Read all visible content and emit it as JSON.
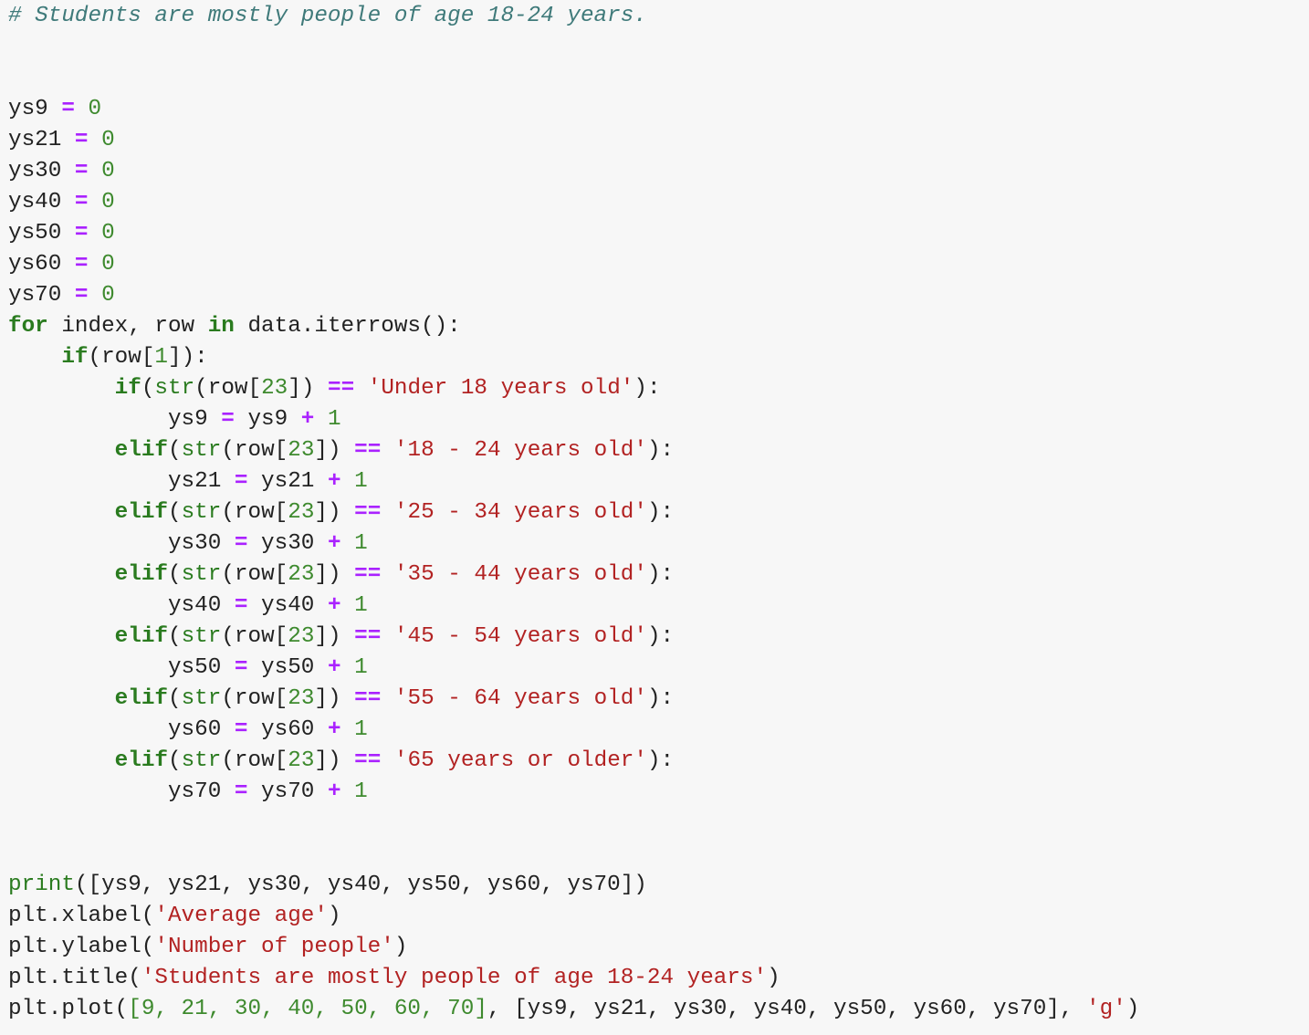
{
  "colors": {
    "background": "#f7f7f7",
    "plain": "#222222",
    "keyword": "#2a7b1f",
    "operator": "#aa22ff",
    "number": "#3e8a2e",
    "string": "#b22222",
    "builtin": "#2a7b1f",
    "comment": "#3f7a7a"
  },
  "code_lines": [
    [
      [
        "comment",
        "# Students are mostly people of age 18-24 years."
      ]
    ],
    [],
    [],
    [
      [
        "plain",
        "ys9 "
      ],
      [
        "op",
        "="
      ],
      [
        "plain",
        " "
      ],
      [
        "num",
        "0"
      ]
    ],
    [
      [
        "plain",
        "ys21 "
      ],
      [
        "op",
        "="
      ],
      [
        "plain",
        " "
      ],
      [
        "num",
        "0"
      ]
    ],
    [
      [
        "plain",
        "ys30 "
      ],
      [
        "op",
        "="
      ],
      [
        "plain",
        " "
      ],
      [
        "num",
        "0"
      ]
    ],
    [
      [
        "plain",
        "ys40 "
      ],
      [
        "op",
        "="
      ],
      [
        "plain",
        " "
      ],
      [
        "num",
        "0"
      ]
    ],
    [
      [
        "plain",
        "ys50 "
      ],
      [
        "op",
        "="
      ],
      [
        "plain",
        " "
      ],
      [
        "num",
        "0"
      ]
    ],
    [
      [
        "plain",
        "ys60 "
      ],
      [
        "op",
        "="
      ],
      [
        "plain",
        " "
      ],
      [
        "num",
        "0"
      ]
    ],
    [
      [
        "plain",
        "ys70 "
      ],
      [
        "op",
        "="
      ],
      [
        "plain",
        " "
      ],
      [
        "num",
        "0"
      ]
    ],
    [
      [
        "kw",
        "for"
      ],
      [
        "plain",
        " index, row "
      ],
      [
        "kw",
        "in"
      ],
      [
        "plain",
        " data.iterrows():"
      ]
    ],
    [
      [
        "plain",
        "    "
      ],
      [
        "kw",
        "if"
      ],
      [
        "plain",
        "(row["
      ],
      [
        "num",
        "1"
      ],
      [
        "plain",
        "]):"
      ]
    ],
    [
      [
        "plain",
        "        "
      ],
      [
        "kw",
        "if"
      ],
      [
        "plain",
        "("
      ],
      [
        "builtin",
        "str"
      ],
      [
        "plain",
        "(row["
      ],
      [
        "num",
        "23"
      ],
      [
        "plain",
        "]) "
      ],
      [
        "op",
        "=="
      ],
      [
        "plain",
        " "
      ],
      [
        "str",
        "'Under 18 years old'"
      ],
      [
        "plain",
        "):"
      ]
    ],
    [
      [
        "plain",
        "            ys9 "
      ],
      [
        "op",
        "="
      ],
      [
        "plain",
        " ys9 "
      ],
      [
        "op",
        "+"
      ],
      [
        "plain",
        " "
      ],
      [
        "num",
        "1"
      ]
    ],
    [
      [
        "plain",
        "        "
      ],
      [
        "kw",
        "elif"
      ],
      [
        "plain",
        "("
      ],
      [
        "builtin",
        "str"
      ],
      [
        "plain",
        "(row["
      ],
      [
        "num",
        "23"
      ],
      [
        "plain",
        "]) "
      ],
      [
        "op",
        "=="
      ],
      [
        "plain",
        " "
      ],
      [
        "str",
        "'18 - 24 years old'"
      ],
      [
        "plain",
        "):"
      ]
    ],
    [
      [
        "plain",
        "            ys21 "
      ],
      [
        "op",
        "="
      ],
      [
        "plain",
        " ys21 "
      ],
      [
        "op",
        "+"
      ],
      [
        "plain",
        " "
      ],
      [
        "num",
        "1"
      ]
    ],
    [
      [
        "plain",
        "        "
      ],
      [
        "kw",
        "elif"
      ],
      [
        "plain",
        "("
      ],
      [
        "builtin",
        "str"
      ],
      [
        "plain",
        "(row["
      ],
      [
        "num",
        "23"
      ],
      [
        "plain",
        "]) "
      ],
      [
        "op",
        "=="
      ],
      [
        "plain",
        " "
      ],
      [
        "str",
        "'25 - 34 years old'"
      ],
      [
        "plain",
        "):"
      ]
    ],
    [
      [
        "plain",
        "            ys30 "
      ],
      [
        "op",
        "="
      ],
      [
        "plain",
        " ys30 "
      ],
      [
        "op",
        "+"
      ],
      [
        "plain",
        " "
      ],
      [
        "num",
        "1"
      ]
    ],
    [
      [
        "plain",
        "        "
      ],
      [
        "kw",
        "elif"
      ],
      [
        "plain",
        "("
      ],
      [
        "builtin",
        "str"
      ],
      [
        "plain",
        "(row["
      ],
      [
        "num",
        "23"
      ],
      [
        "plain",
        "]) "
      ],
      [
        "op",
        "=="
      ],
      [
        "plain",
        " "
      ],
      [
        "str",
        "'35 - 44 years old'"
      ],
      [
        "plain",
        "):"
      ]
    ],
    [
      [
        "plain",
        "            ys40 "
      ],
      [
        "op",
        "="
      ],
      [
        "plain",
        " ys40 "
      ],
      [
        "op",
        "+"
      ],
      [
        "plain",
        " "
      ],
      [
        "num",
        "1"
      ]
    ],
    [
      [
        "plain",
        "        "
      ],
      [
        "kw",
        "elif"
      ],
      [
        "plain",
        "("
      ],
      [
        "builtin",
        "str"
      ],
      [
        "plain",
        "(row["
      ],
      [
        "num",
        "23"
      ],
      [
        "plain",
        "]) "
      ],
      [
        "op",
        "=="
      ],
      [
        "plain",
        " "
      ],
      [
        "str",
        "'45 - 54 years old'"
      ],
      [
        "plain",
        "):"
      ]
    ],
    [
      [
        "plain",
        "            ys50 "
      ],
      [
        "op",
        "="
      ],
      [
        "plain",
        " ys50 "
      ],
      [
        "op",
        "+"
      ],
      [
        "plain",
        " "
      ],
      [
        "num",
        "1"
      ]
    ],
    [
      [
        "plain",
        "        "
      ],
      [
        "kw",
        "elif"
      ],
      [
        "plain",
        "("
      ],
      [
        "builtin",
        "str"
      ],
      [
        "plain",
        "(row["
      ],
      [
        "num",
        "23"
      ],
      [
        "plain",
        "]) "
      ],
      [
        "op",
        "=="
      ],
      [
        "plain",
        " "
      ],
      [
        "str",
        "'55 - 64 years old'"
      ],
      [
        "plain",
        "):"
      ]
    ],
    [
      [
        "plain",
        "            ys60 "
      ],
      [
        "op",
        "="
      ],
      [
        "plain",
        " ys60 "
      ],
      [
        "op",
        "+"
      ],
      [
        "plain",
        " "
      ],
      [
        "num",
        "1"
      ]
    ],
    [
      [
        "plain",
        "        "
      ],
      [
        "kw",
        "elif"
      ],
      [
        "plain",
        "("
      ],
      [
        "builtin",
        "str"
      ],
      [
        "plain",
        "(row["
      ],
      [
        "num",
        "23"
      ],
      [
        "plain",
        "]) "
      ],
      [
        "op",
        "=="
      ],
      [
        "plain",
        " "
      ],
      [
        "str",
        "'65 years or older'"
      ],
      [
        "plain",
        "):"
      ]
    ],
    [
      [
        "plain",
        "            ys70 "
      ],
      [
        "op",
        "="
      ],
      [
        "plain",
        " ys70 "
      ],
      [
        "op",
        "+"
      ],
      [
        "plain",
        " "
      ],
      [
        "num",
        "1"
      ]
    ],
    [],
    [],
    [
      [
        "builtin",
        "print"
      ],
      [
        "plain",
        "([ys9, ys21, ys30, ys40, ys50, ys60, ys70])"
      ]
    ],
    [
      [
        "plain",
        "plt.xlabel("
      ],
      [
        "str",
        "'Average age'"
      ],
      [
        "plain",
        ")"
      ]
    ],
    [
      [
        "plain",
        "plt.ylabel("
      ],
      [
        "str",
        "'Number of people'"
      ],
      [
        "plain",
        ")"
      ]
    ],
    [
      [
        "plain",
        "plt.title("
      ],
      [
        "str",
        "'Students are mostly people of age 18-24 years'"
      ],
      [
        "plain",
        ")"
      ]
    ],
    [
      [
        "plain",
        "plt.plot("
      ],
      [
        "num",
        "[9, 21, 30, 40, 50, 60, 70]"
      ],
      [
        "plain",
        ", [ys9, ys21, ys30, ys40, ys50, ys60, ys70], "
      ],
      [
        "str",
        "'g'"
      ],
      [
        "plain",
        ")"
      ]
    ]
  ]
}
